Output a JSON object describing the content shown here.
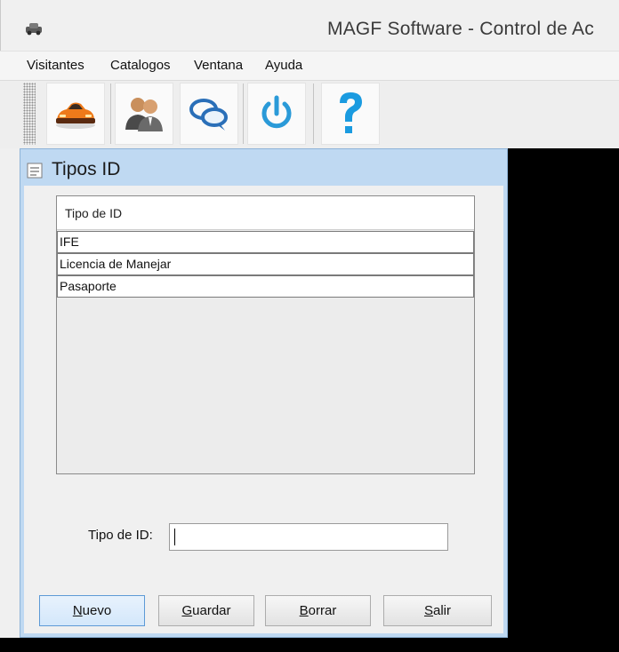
{
  "window": {
    "title": "MAGF Software - Control de Ac",
    "icon": "app-car-icon"
  },
  "menu": {
    "items": [
      "Visitantes",
      "Catalogos",
      "Ventana",
      "Ayuda"
    ]
  },
  "toolbar": {
    "buttons": [
      "car-icon",
      "users-icon",
      "chat-bubbles-icon",
      "power-icon",
      "help-icon"
    ]
  },
  "dialog": {
    "title": "Tipos ID",
    "table": {
      "header": "Tipo de ID",
      "rows": [
        "IFE",
        "Licencia de Manejar",
        "Pasaporte"
      ]
    },
    "field": {
      "label": "Tipo de ID:",
      "value": ""
    },
    "buttons": {
      "nuevo": "Nuevo",
      "guardar": "Guardar",
      "borrar": "Borrar",
      "salir": "Salir"
    }
  },
  "colors": {
    "dialog_frame": "#bfd9f2",
    "desktop": "#000000",
    "help": "#1a9be0"
  }
}
